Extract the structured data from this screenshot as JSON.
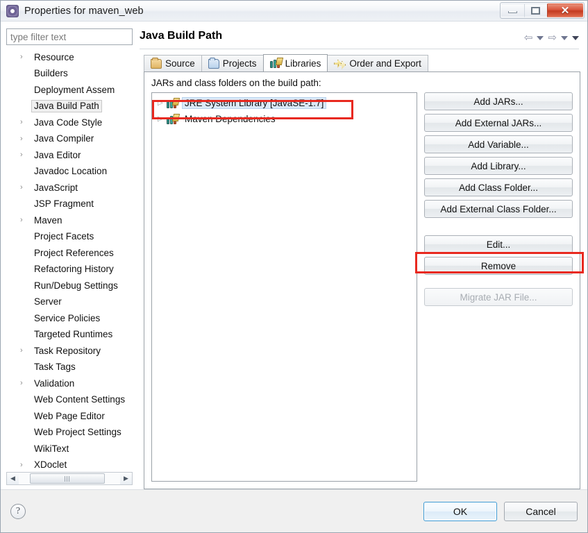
{
  "window": {
    "title": "Properties for maven_web",
    "app_icon": "eclipse-icon",
    "buttons": {
      "minimize": "minimize-icon",
      "maximize": "maximize-icon",
      "close": "✕"
    }
  },
  "sidebar": {
    "filter": {
      "placeholder": "type filter text",
      "value": ""
    },
    "items": [
      {
        "label": "Resource",
        "expandable": true,
        "selected": false
      },
      {
        "label": "Builders",
        "expandable": false,
        "selected": false
      },
      {
        "label": "Deployment Assem",
        "expandable": false,
        "selected": false
      },
      {
        "label": "Java Build Path",
        "expandable": false,
        "selected": true
      },
      {
        "label": "Java Code Style",
        "expandable": true,
        "selected": false
      },
      {
        "label": "Java Compiler",
        "expandable": true,
        "selected": false
      },
      {
        "label": "Java Editor",
        "expandable": true,
        "selected": false
      },
      {
        "label": "Javadoc Location",
        "expandable": false,
        "selected": false
      },
      {
        "label": "JavaScript",
        "expandable": true,
        "selected": false
      },
      {
        "label": "JSP Fragment",
        "expandable": false,
        "selected": false
      },
      {
        "label": "Maven",
        "expandable": true,
        "selected": false
      },
      {
        "label": "Project Facets",
        "expandable": false,
        "selected": false
      },
      {
        "label": "Project References",
        "expandable": false,
        "selected": false
      },
      {
        "label": "Refactoring History",
        "expandable": false,
        "selected": false
      },
      {
        "label": "Run/Debug Settings",
        "expandable": false,
        "selected": false
      },
      {
        "label": "Server",
        "expandable": false,
        "selected": false
      },
      {
        "label": "Service Policies",
        "expandable": false,
        "selected": false
      },
      {
        "label": "Targeted Runtimes",
        "expandable": false,
        "selected": false
      },
      {
        "label": "Task Repository",
        "expandable": true,
        "selected": false
      },
      {
        "label": "Task Tags",
        "expandable": false,
        "selected": false
      },
      {
        "label": "Validation",
        "expandable": true,
        "selected": false
      },
      {
        "label": "Web Content Settings",
        "expandable": false,
        "selected": false
      },
      {
        "label": "Web Page Editor",
        "expandable": false,
        "selected": false
      },
      {
        "label": "Web Project Settings",
        "expandable": false,
        "selected": false
      },
      {
        "label": "WikiText",
        "expandable": false,
        "selected": false
      },
      {
        "label": "XDoclet",
        "expandable": true,
        "selected": false
      }
    ],
    "scrollbar": {
      "left_arrow": "◀",
      "right_arrow": "▶"
    }
  },
  "page": {
    "title": "Java Build Path",
    "nav": {
      "back": "⇦",
      "forward": "⇨"
    }
  },
  "tabs": [
    {
      "label": "Source",
      "icon": "package-folder-icon",
      "active": false
    },
    {
      "label": "Projects",
      "icon": "blue-folder-icon",
      "active": false
    },
    {
      "label": "Libraries",
      "icon": "library-books-icon",
      "active": true
    },
    {
      "label": "Order and Export",
      "icon": "order-arrows-icon",
      "active": false
    }
  ],
  "libraries_tab": {
    "description": "JARs and class folders on the build path:",
    "entries": [
      {
        "label": "JRE System Library [JavaSE-1.7]",
        "icon": "library-books-icon",
        "expandable": true,
        "selected": true,
        "annotated": true
      },
      {
        "label": "Maven Dependencies",
        "icon": "library-books-icon",
        "expandable": true,
        "selected": false,
        "annotated": false
      }
    ],
    "buttons": [
      {
        "label": "Add JARs...",
        "enabled": true,
        "annotated": false
      },
      {
        "label": "Add External JARs...",
        "enabled": true,
        "annotated": false
      },
      {
        "label": "Add Variable...",
        "enabled": true,
        "annotated": false
      },
      {
        "label": "Add Library...",
        "enabled": true,
        "annotated": false
      },
      {
        "label": "Add Class Folder...",
        "enabled": true,
        "annotated": false
      },
      {
        "label": "Add External Class Folder...",
        "enabled": true,
        "annotated": false
      },
      {
        "label": "Edit...",
        "enabled": true,
        "annotated": true
      },
      {
        "label": "Remove",
        "enabled": true,
        "annotated": false
      },
      {
        "label": "Migrate JAR File...",
        "enabled": false,
        "annotated": false
      }
    ]
  },
  "footer": {
    "help": "?",
    "ok": "OK",
    "cancel": "Cancel"
  },
  "colors": {
    "annotation_red": "#e8291f",
    "selection_blue": "#dbe9f7",
    "default_button_border": "#3d9ad4",
    "close_button_red": "#c33a20"
  }
}
